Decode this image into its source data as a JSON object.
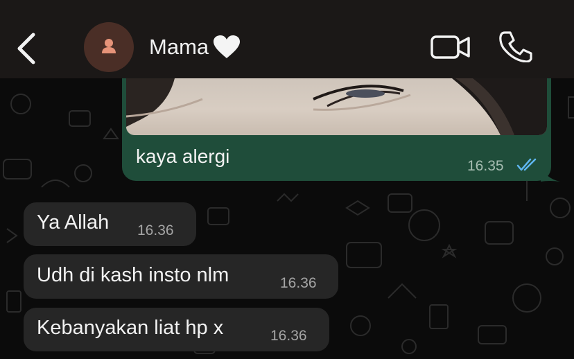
{
  "header": {
    "contact_name": "Mama",
    "contact_emoji": "heart"
  },
  "messages": [
    {
      "direction": "outgoing",
      "has_image": true,
      "text": "kaya alergi",
      "time": "16.35",
      "status": "read"
    },
    {
      "direction": "incoming",
      "text": "Ya Allah",
      "time": "16.36"
    },
    {
      "direction": "incoming",
      "text": "Udh di kash insto nlm",
      "time": "16.36"
    },
    {
      "direction": "incoming",
      "text": "Kebanyakan liat hp x",
      "time": "16.36"
    }
  ],
  "colors": {
    "header_bg": "#1b1817",
    "chat_bg": "#0b0b0b",
    "outgoing_bubble": "#1f4d3a",
    "incoming_bubble": "#262626",
    "read_ticks": "#5fb6f0",
    "avatar_bg": "#4a2e26",
    "avatar_icon": "#e69379"
  }
}
